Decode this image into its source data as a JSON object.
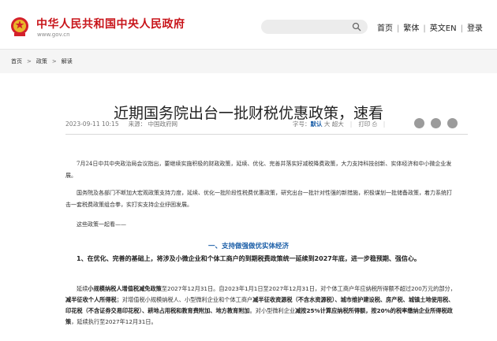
{
  "header": {
    "site_name": "中华人民共和国中央人民政府",
    "site_url": "www.gov.cn",
    "nav": [
      "首页",
      "繁体",
      "英文EN",
      "登录"
    ]
  },
  "breadcrumb": [
    "首页",
    "政策",
    "解读"
  ],
  "article": {
    "title": "近期国务院出台一批财税优惠政策，速看",
    "date": "2023-09-11 10:15",
    "source": "来源： 中国政府网",
    "font_label": "字号：",
    "font_default": "默认",
    "font_large": "大",
    "font_xlarge": "超大",
    "print": "打印",
    "intro": [
      "7月24日中共中央政治局会议指出，要继续实施积极的财政政策，延续、优化、完善并落实好减税降费政策，大力支持科技创新、实体经济和中小微企业发展。",
      "国务院及各部门不断加大宏观政策支持力度，延续、优化一批阶段性税费优惠政策，研究出台一批针对性强的新措施，积极谋划一批储备政策，着力系统打击一套税费政策组合拳，实打实支持企业纾困发展。",
      "这些政策一起看——"
    ],
    "section1": "一、支持做强做优实体经济",
    "sub1": "1、在优化、完善的基础上，将涉及小微企业和个体工商户的到期税费政策统一延续到2027年底，进一步稳预期、强信心。",
    "body_parts": [
      "延续",
      "小规模纳税人增值税减免政策",
      "至2027年12月31日。自2023年1月1日至2027年12月31日，对个体工商户年应纳税所得额不超过200万元的部分，",
      "减半征收个人所得税",
      "；对增值税小规模纳税人、小型微利企业和个体工商户",
      "减半征收资源税（不含水资源税）、城市维护建设税、房产税、城镇土地使用税、印花税（不含证券交易印花税）、耕地占用税和教育费附加、地方教育附加",
      "。对小型微利企业",
      "减按25%计算应纳税所得额，按20%的税率缴纳企业所得税政策",
      "，延续执行至2027年12月31日。"
    ]
  },
  "colors": {
    "brand_red": "#c8141a",
    "link_blue": "#1c5fa8"
  }
}
